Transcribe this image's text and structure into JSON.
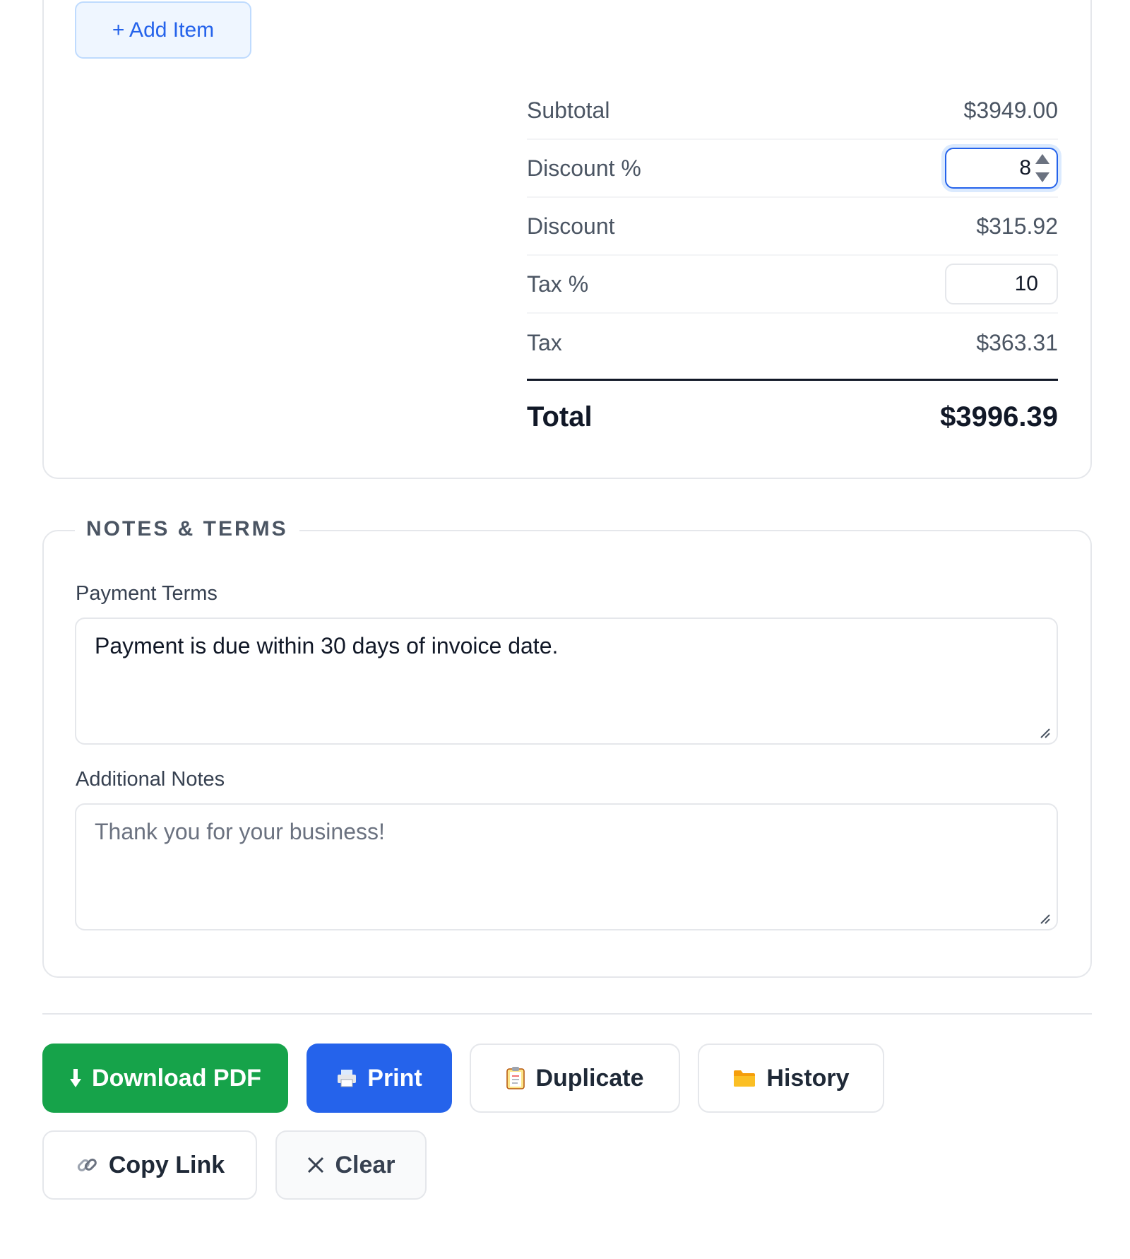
{
  "add_item": {
    "label": "+ Add Item"
  },
  "totals": {
    "subtotal_label": "Subtotal",
    "subtotal_value": "$3949.00",
    "discount_pct_label": "Discount %",
    "discount_pct_value": "8",
    "discount_label": "Discount",
    "discount_value": "$315.92",
    "tax_pct_label": "Tax %",
    "tax_pct_value": "10",
    "tax_label": "Tax",
    "tax_value": "$363.31",
    "total_label": "Total",
    "total_value": "$3996.39"
  },
  "notes": {
    "section_title": "NOTES & TERMS",
    "payment_terms_label": "Payment Terms",
    "payment_terms_value": "Payment is due within 30 days of invoice date.",
    "additional_notes_label": "Additional Notes",
    "additional_notes_placeholder": "Thank you for your business!"
  },
  "actions": {
    "download_pdf": "Download PDF",
    "print": "Print",
    "duplicate": "Duplicate",
    "history": "History",
    "copy_link": "Copy Link",
    "clear": "Clear"
  },
  "icons": {
    "download": "download-arrow-icon",
    "print": "printer-icon",
    "duplicate": "clipboard-icon",
    "history": "folder-icon",
    "copy_link": "link-icon",
    "clear": "close-icon"
  },
  "colors": {
    "primary_blue": "#2563eb",
    "success_green": "#16a34a",
    "border": "#e5e7eb",
    "text_muted": "#4b5563"
  }
}
